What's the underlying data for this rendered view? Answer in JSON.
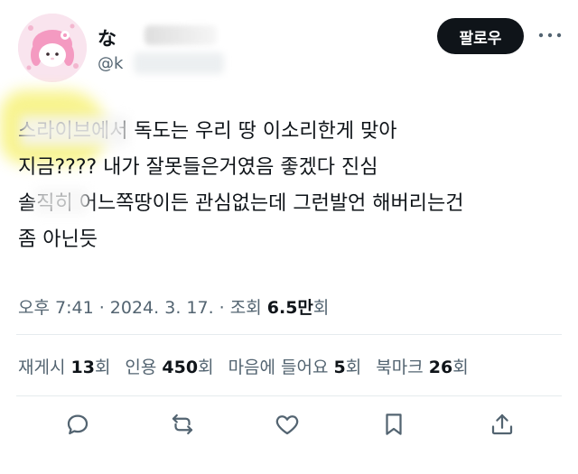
{
  "author": {
    "display_name": "な",
    "handle": "@k"
  },
  "follow_button": {
    "label": "팔로우"
  },
  "more_icon": "more-dots-icon",
  "tweet": {
    "text": "      스라이브에서 독도는 우리 땅 이소리한게 맞아\n지금???? 내가 잘못들은거였음 좋겠다 진심\n솔직히 어느쪽땅이든 관심없는데 그런발언 해버리는건\n좀 아닌듯"
  },
  "meta": {
    "time": "오후 7:41",
    "sep1": " · ",
    "date": "2024. 3. 17.",
    "sep2": " · ",
    "views_label": "조회 ",
    "views_value": "6.5만",
    "views_suffix": "회"
  },
  "stats": {
    "reposts": {
      "label": "재게시 ",
      "value": "13",
      "suffix": "회"
    },
    "quotes": {
      "label": "인용 ",
      "value": "450",
      "suffix": "회"
    },
    "likes": {
      "label": "마음에 들어요 ",
      "value": "5",
      "suffix": "회"
    },
    "bookmarks": {
      "label": "북마크 ",
      "value": "26",
      "suffix": "회"
    }
  },
  "action_icons": [
    "reply-icon",
    "repost-icon",
    "like-icon",
    "bookmark-icon",
    "share-icon"
  ],
  "colors": {
    "text_primary": "#0f1419",
    "text_secondary": "#536471",
    "follow_bg": "#0f1419",
    "highlight": "#f7f27a"
  }
}
